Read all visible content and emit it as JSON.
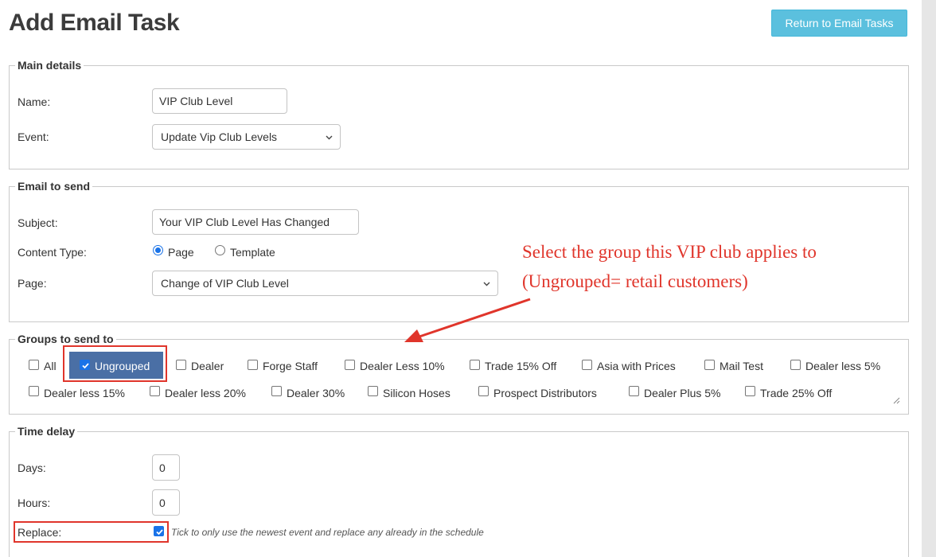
{
  "page": {
    "title": "Add Email Task",
    "return_button": "Return to Email Tasks"
  },
  "main_details": {
    "legend": "Main details",
    "name_label": "Name:",
    "name_value": "VIP Club Level",
    "event_label": "Event:",
    "event_value": "Update Vip Club Levels"
  },
  "email_to_send": {
    "legend": "Email to send",
    "subject_label": "Subject:",
    "subject_value": "Your VIP Club Level Has Changed",
    "content_type_label": "Content Type:",
    "content_type_options": [
      "Page",
      "Template"
    ],
    "content_type_selected": "Page",
    "page_label": "Page:",
    "page_value": "Change of VIP Club Level"
  },
  "groups": {
    "legend": "Groups to send to",
    "items": [
      {
        "label": "All",
        "checked": false
      },
      {
        "label": "Ungrouped",
        "checked": true
      },
      {
        "label": "Dealer",
        "checked": false
      },
      {
        "label": "Forge Staff",
        "checked": false
      },
      {
        "label": "Dealer Less 10%",
        "checked": false
      },
      {
        "label": "Trade 15% Off",
        "checked": false
      },
      {
        "label": "Asia with Prices",
        "checked": false
      },
      {
        "label": "Mail Test",
        "checked": false
      },
      {
        "label": "Dealer less 5%",
        "checked": false
      },
      {
        "label": "Dealer less 15%",
        "checked": false
      },
      {
        "label": "Dealer less 20%",
        "checked": false
      },
      {
        "label": "Dealer 30%",
        "checked": false
      },
      {
        "label": "Silicon Hoses",
        "checked": false
      },
      {
        "label": "Prospect Distributors",
        "checked": false
      },
      {
        "label": "Dealer Plus 5%",
        "checked": false
      },
      {
        "label": "Trade 25% Off",
        "checked": false
      }
    ]
  },
  "time_delay": {
    "legend": "Time delay",
    "days_label": "Days:",
    "days_value": "0",
    "hours_label": "Hours:",
    "hours_value": "0",
    "replace_label": "Replace:",
    "replace_checked": true,
    "replace_hint": "Tick to only use the newest event and replace any already in the schedule"
  },
  "annotation": {
    "line1": "Select the group this VIP club applies to",
    "line2": "(Ungrouped= retail customers)"
  },
  "colors": {
    "accent": "#5bc0de",
    "check": "#1a73e8",
    "annotation": "#e0352b",
    "chip": "#4a6fa5"
  }
}
